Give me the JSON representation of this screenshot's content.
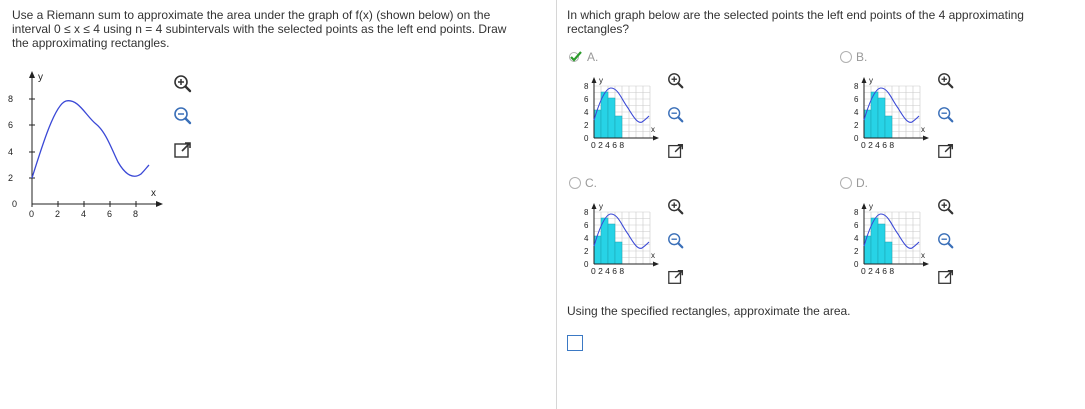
{
  "left_question": {
    "lines": [
      "Use a Riemann sum to approximate the area under the graph of f(x) (shown below) on the",
      "interval 0 ≤ x ≤ 4 using n = 4 subintervals with the selected points as the left end points. Draw",
      "the approximating rectangles."
    ]
  },
  "right_question": {
    "lines": [
      "In which graph below are the selected points the left end points of the 4 approximating",
      "rectangles?"
    ]
  },
  "main_graph": {
    "x_ticks": [
      "0",
      "2",
      "4",
      "6",
      "8"
    ],
    "y_ticks": [
      "8",
      "6",
      "4",
      "2",
      "0"
    ],
    "x_axis_label": "x",
    "y_axis_label": "y"
  },
  "options": [
    {
      "letter": "A.",
      "selected": true
    },
    {
      "letter": "B.",
      "selected": false
    },
    {
      "letter": "C.",
      "selected": false
    },
    {
      "letter": "D.",
      "selected": false
    }
  ],
  "small_graph": {
    "x_ticks": "0 2 4 6 8",
    "y_ticks": [
      "8",
      "6",
      "4",
      "2",
      "0"
    ],
    "x_axis_label": "x",
    "y_axis_label": "y"
  },
  "area_prompt": "Using the specified rectangles, approximate the area.",
  "icons": [
    "zoom-in-icon",
    "zoom-out-icon",
    "expand-icon"
  ],
  "colors": {
    "curve": "#3a48d6",
    "fill": "#27d3e6",
    "accent": "#3b79c4",
    "check": "#2c9b2c"
  }
}
